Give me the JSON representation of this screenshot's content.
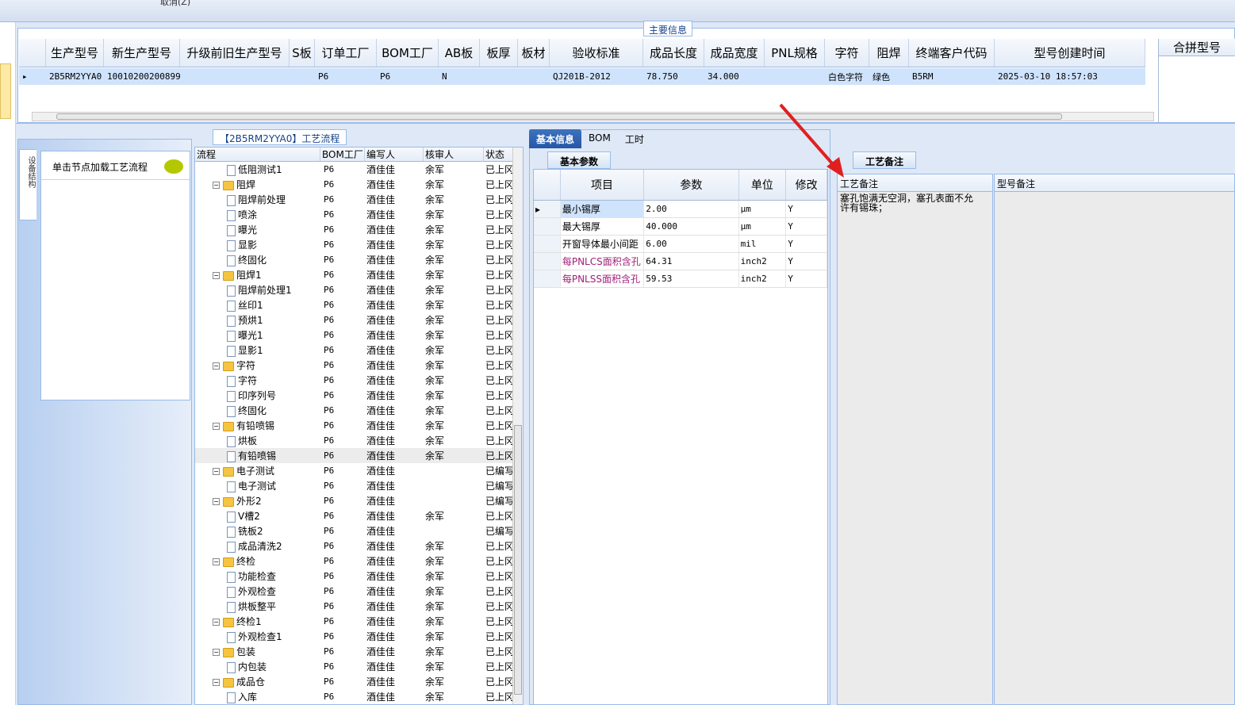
{
  "topbar": {
    "cancel_label": "取消(Z)"
  },
  "main_info": {
    "group_title": "主要信息",
    "columns": [
      "生产型号",
      "新生产型号",
      "升级前旧生产型号",
      "S板",
      "订单工厂",
      "BOM工厂",
      "AB板",
      "板厚",
      "板材",
      "验收标准",
      "成品长度",
      "成品宽度",
      "PNL规格",
      "字符",
      "阻焊",
      "终端客户代码",
      "型号创建时间"
    ],
    "row": [
      "2B5RM2YYA0",
      "10010200200899",
      "",
      "",
      "P6",
      "P6",
      "N",
      "",
      "",
      "QJ201B-2012",
      "78.750",
      "34.000",
      "",
      "白色字符",
      "绿色",
      "B5RM",
      "2025-03-10 18:57:03"
    ],
    "merge_header": "合拼型号"
  },
  "left_panel": {
    "vertical_tab": "设备结构",
    "load_hint": "单击节点加载工艺流程"
  },
  "flow": {
    "title": "【2B5RM2YYA0】工艺流程",
    "columns": [
      "流程",
      "BOM工厂",
      "编写人",
      "核审人",
      "状态"
    ],
    "rows": [
      {
        "level": 2,
        "type": "doc",
        "name": "低阻测试1",
        "bom": "P6",
        "writer": "酒佳佳",
        "reviewer": "余军",
        "status": "已上冈"
      },
      {
        "level": 1,
        "type": "folder",
        "name": "阻焊",
        "bom": "P6",
        "writer": "酒佳佳",
        "reviewer": "余军",
        "status": "已上冈"
      },
      {
        "level": 2,
        "type": "doc",
        "name": "阻焊前处理",
        "bom": "P6",
        "writer": "酒佳佳",
        "reviewer": "余军",
        "status": "已上冈"
      },
      {
        "level": 2,
        "type": "doc",
        "name": "喷涂",
        "bom": "P6",
        "writer": "酒佳佳",
        "reviewer": "余军",
        "status": "已上冈"
      },
      {
        "level": 2,
        "type": "doc",
        "name": "曝光",
        "bom": "P6",
        "writer": "酒佳佳",
        "reviewer": "余军",
        "status": "已上冈"
      },
      {
        "level": 2,
        "type": "doc",
        "name": "显影",
        "bom": "P6",
        "writer": "酒佳佳",
        "reviewer": "余军",
        "status": "已上冈"
      },
      {
        "level": 2,
        "type": "doc",
        "name": "终固化",
        "bom": "P6",
        "writer": "酒佳佳",
        "reviewer": "余军",
        "status": "已上冈"
      },
      {
        "level": 1,
        "type": "folder",
        "name": "阻焊1",
        "bom": "P6",
        "writer": "酒佳佳",
        "reviewer": "余军",
        "status": "已上冈"
      },
      {
        "level": 2,
        "type": "doc",
        "name": "阻焊前处理1",
        "bom": "P6",
        "writer": "酒佳佳",
        "reviewer": "余军",
        "status": "已上冈"
      },
      {
        "level": 2,
        "type": "doc",
        "name": "丝印1",
        "bom": "P6",
        "writer": "酒佳佳",
        "reviewer": "余军",
        "status": "已上冈"
      },
      {
        "level": 2,
        "type": "doc",
        "name": "预烘1",
        "bom": "P6",
        "writer": "酒佳佳",
        "reviewer": "余军",
        "status": "已上冈"
      },
      {
        "level": 2,
        "type": "doc",
        "name": "曝光1",
        "bom": "P6",
        "writer": "酒佳佳",
        "reviewer": "余军",
        "status": "已上冈"
      },
      {
        "level": 2,
        "type": "doc",
        "name": "显影1",
        "bom": "P6",
        "writer": "酒佳佳",
        "reviewer": "余军",
        "status": "已上冈"
      },
      {
        "level": 1,
        "type": "folder",
        "name": "字符",
        "bom": "P6",
        "writer": "酒佳佳",
        "reviewer": "余军",
        "status": "已上冈"
      },
      {
        "level": 2,
        "type": "doc",
        "name": "字符",
        "bom": "P6",
        "writer": "酒佳佳",
        "reviewer": "余军",
        "status": "已上冈"
      },
      {
        "level": 2,
        "type": "doc",
        "name": "印序列号",
        "bom": "P6",
        "writer": "酒佳佳",
        "reviewer": "余军",
        "status": "已上冈"
      },
      {
        "level": 2,
        "type": "doc",
        "name": "终固化",
        "bom": "P6",
        "writer": "酒佳佳",
        "reviewer": "余军",
        "status": "已上冈"
      },
      {
        "level": 1,
        "type": "folder",
        "name": "有铅喷锡",
        "bom": "P6",
        "writer": "酒佳佳",
        "reviewer": "余军",
        "status": "已上冈"
      },
      {
        "level": 2,
        "type": "doc",
        "name": "烘板",
        "bom": "P6",
        "writer": "酒佳佳",
        "reviewer": "余军",
        "status": "已上冈"
      },
      {
        "level": 2,
        "type": "doc",
        "name": "有铅喷锡",
        "bom": "P6",
        "writer": "酒佳佳",
        "reviewer": "余军",
        "status": "已上冈",
        "selected": true
      },
      {
        "level": 1,
        "type": "folder",
        "name": "电子测试",
        "bom": "P6",
        "writer": "酒佳佳",
        "reviewer": "",
        "status": "已编写"
      },
      {
        "level": 2,
        "type": "doc",
        "name": "电子测试",
        "bom": "P6",
        "writer": "酒佳佳",
        "reviewer": "",
        "status": "已编写"
      },
      {
        "level": 1,
        "type": "folder",
        "name": "外形2",
        "bom": "P6",
        "writer": "酒佳佳",
        "reviewer": "",
        "status": "已编写"
      },
      {
        "level": 2,
        "type": "doc",
        "name": "V槽2",
        "bom": "P6",
        "writer": "酒佳佳",
        "reviewer": "余军",
        "status": "已上冈"
      },
      {
        "level": 2,
        "type": "doc",
        "name": "铣板2",
        "bom": "P6",
        "writer": "酒佳佳",
        "reviewer": "",
        "status": "已编写"
      },
      {
        "level": 2,
        "type": "doc",
        "name": "成品清洗2",
        "bom": "P6",
        "writer": "酒佳佳",
        "reviewer": "余军",
        "status": "已上冈"
      },
      {
        "level": 1,
        "type": "folder",
        "name": "终检",
        "bom": "P6",
        "writer": "酒佳佳",
        "reviewer": "余军",
        "status": "已上冈"
      },
      {
        "level": 2,
        "type": "doc",
        "name": "功能检查",
        "bom": "P6",
        "writer": "酒佳佳",
        "reviewer": "余军",
        "status": "已上冈"
      },
      {
        "level": 2,
        "type": "doc",
        "name": "外观检查",
        "bom": "P6",
        "writer": "酒佳佳",
        "reviewer": "余军",
        "status": "已上冈"
      },
      {
        "level": 2,
        "type": "doc",
        "name": "烘板整平",
        "bom": "P6",
        "writer": "酒佳佳",
        "reviewer": "余军",
        "status": "已上冈"
      },
      {
        "level": 1,
        "type": "folder",
        "name": "终检1",
        "bom": "P6",
        "writer": "酒佳佳",
        "reviewer": "余军",
        "status": "已上冈"
      },
      {
        "level": 2,
        "type": "doc",
        "name": "外观检查1",
        "bom": "P6",
        "writer": "酒佳佳",
        "reviewer": "余军",
        "status": "已上冈"
      },
      {
        "level": 1,
        "type": "folder",
        "name": "包装",
        "bom": "P6",
        "writer": "酒佳佳",
        "reviewer": "余军",
        "status": "已上冈"
      },
      {
        "level": 2,
        "type": "doc",
        "name": "内包装",
        "bom": "P6",
        "writer": "酒佳佳",
        "reviewer": "余军",
        "status": "已上冈"
      },
      {
        "level": 1,
        "type": "folder",
        "name": "成品仓",
        "bom": "P6",
        "writer": "酒佳佳",
        "reviewer": "余军",
        "status": "已上冈"
      },
      {
        "level": 2,
        "type": "doc",
        "name": "入库",
        "bom": "P6",
        "writer": "酒佳佳",
        "reviewer": "余军",
        "status": "已上冈"
      }
    ]
  },
  "mid_tabs": [
    "基本信息",
    "BOM",
    "工时"
  ],
  "params": {
    "subtab": "基本参数",
    "columns": [
      "项目",
      "参数",
      "单位",
      "修改"
    ],
    "rows": [
      {
        "item": "最小锡厚",
        "value": "2.00",
        "unit": "μm",
        "mod": "Y",
        "color": "#000000"
      },
      {
        "item": "最大锡厚",
        "value": "40.000",
        "unit": "μm",
        "mod": "Y",
        "color": "#000000"
      },
      {
        "item": "开窗导体最小间距",
        "value": "6.00",
        "unit": "mil",
        "mod": "Y",
        "color": "#000000"
      },
      {
        "item": "每PNLCS面积含孔",
        "value": "64.31",
        "unit": "inch2",
        "mod": "Y",
        "color": "#a0207a"
      },
      {
        "item": "每PNLSS面积含孔",
        "value": "59.53",
        "unit": "inch2",
        "mod": "Y",
        "color": "#a0207a"
      }
    ]
  },
  "notes": {
    "tab": "工艺备注",
    "process_header": "工艺备注",
    "model_header": "型号备注",
    "process_text": "塞孔饱满无空洞，塞孔表面不允许有锡珠；"
  },
  "colors": {
    "accent": "#2457a7",
    "arrow": "#e02020",
    "selection": "#cfe3fc"
  }
}
